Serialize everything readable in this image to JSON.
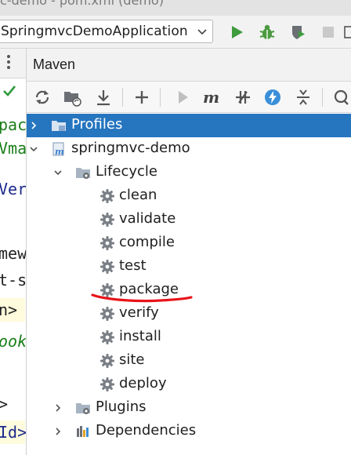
{
  "window": {
    "title": "c-demo - pom.xml (demo)"
  },
  "run_toolbar": {
    "configuration": "SpringmvcDemoApplication",
    "buttons": [
      "run-icon",
      "debug-icon",
      "coverage-icon",
      "stop-icon",
      "layout-icon"
    ]
  },
  "editor": {
    "code_fragments": [
      "pac",
      "Vma",
      "Ver",
      "mew",
      "t-s",
      "n>",
      "ook",
      ">",
      "Id>"
    ]
  },
  "maven": {
    "title": "Maven",
    "toolbar_icons": [
      "reload-icon",
      "generate-sources-icon",
      "download-icon",
      "add-icon",
      "run-icon",
      "execute-goal-icon",
      "toggle-offline-icon",
      "skip-tests-icon",
      "collapse-icon",
      "analyze-icon"
    ],
    "tree": {
      "profiles": "Profiles",
      "project": "springmvc-demo",
      "lifecycle": "Lifecycle",
      "goals": [
        "clean",
        "validate",
        "compile",
        "test",
        "package",
        "verify",
        "install",
        "site",
        "deploy"
      ],
      "plugins": "Plugins",
      "dependencies": "Dependencies"
    }
  },
  "colors": {
    "selection": "#2675bf",
    "annotation": "#e8141a",
    "run_green": "#3e9b3e"
  }
}
